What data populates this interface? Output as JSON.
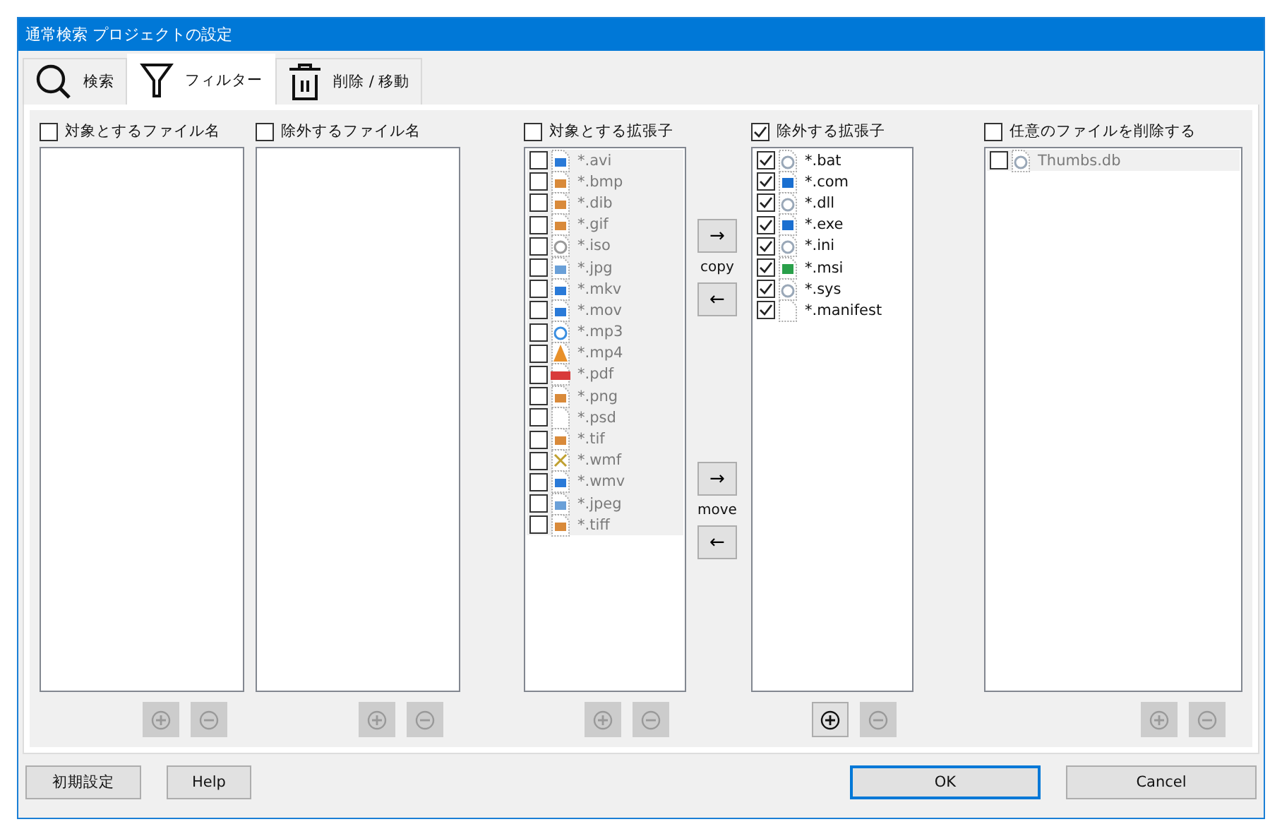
{
  "window": {
    "title": "通常検索 プロジェクトの設定"
  },
  "tabs": [
    {
      "label": "検索",
      "kind": "search",
      "selected": false
    },
    {
      "label": "フィルター",
      "kind": "filter",
      "selected": true
    },
    {
      "label": "削除 / 移動",
      "kind": "trash",
      "selected": false
    }
  ],
  "lists": [
    {
      "label": "対象とするファイル名",
      "checked": false,
      "add_disabled": true,
      "remove_disabled": true
    },
    {
      "label": "除外するファイル名",
      "checked": false,
      "add_disabled": true,
      "remove_disabled": true
    },
    {
      "label": "対象とする拡張子",
      "checked": false,
      "items": [
        {
          "name": "*.avi",
          "checked": false,
          "dimmed": true,
          "kind": "video"
        },
        {
          "name": "*.bmp",
          "checked": false,
          "dimmed": true,
          "kind": "image"
        },
        {
          "name": "*.dib",
          "checked": false,
          "dimmed": true,
          "kind": "image"
        },
        {
          "name": "*.gif",
          "checked": false,
          "dimmed": true,
          "kind": "image"
        },
        {
          "name": "*.iso",
          "checked": false,
          "dimmed": true,
          "kind": "disc"
        },
        {
          "name": "*.jpg",
          "checked": false,
          "dimmed": true,
          "kind": "photo"
        },
        {
          "name": "*.mkv",
          "checked": false,
          "dimmed": true,
          "kind": "video"
        },
        {
          "name": "*.mov",
          "checked": false,
          "dimmed": true,
          "kind": "video"
        },
        {
          "name": "*.mp3",
          "checked": false,
          "dimmed": true,
          "kind": "audio"
        },
        {
          "name": "*.mp4",
          "checked": false,
          "dimmed": true,
          "kind": "cone"
        },
        {
          "name": "*.pdf",
          "checked": false,
          "dimmed": true,
          "kind": "pdf"
        },
        {
          "name": "*.png",
          "checked": false,
          "dimmed": true,
          "kind": "image"
        },
        {
          "name": "*.psd",
          "checked": false,
          "dimmed": true,
          "kind": "blank"
        },
        {
          "name": "*.tif",
          "checked": false,
          "dimmed": true,
          "kind": "image"
        },
        {
          "name": "*.wmf",
          "checked": false,
          "dimmed": true,
          "kind": "drawing"
        },
        {
          "name": "*.wmv",
          "checked": false,
          "dimmed": true,
          "kind": "video"
        },
        {
          "name": "*.jpeg",
          "checked": false,
          "dimmed": true,
          "kind": "photo"
        },
        {
          "name": "*.tiff",
          "checked": false,
          "dimmed": true,
          "kind": "image"
        }
      ],
      "add_disabled": true,
      "remove_disabled": true
    },
    {
      "label": "除外する拡張子",
      "checked": true,
      "items": [
        {
          "name": "*.bat",
          "checked": true,
          "dimmed": false,
          "kind": "gear"
        },
        {
          "name": "*.com",
          "checked": true,
          "dimmed": false,
          "kind": "window"
        },
        {
          "name": "*.dll",
          "checked": true,
          "dimmed": false,
          "kind": "gear"
        },
        {
          "name": "*.exe",
          "checked": true,
          "dimmed": false,
          "kind": "window"
        },
        {
          "name": "*.ini",
          "checked": true,
          "dimmed": false,
          "kind": "gear"
        },
        {
          "name": "*.msi",
          "checked": true,
          "dimmed": false,
          "kind": "installer"
        },
        {
          "name": "*.sys",
          "checked": true,
          "dimmed": false,
          "kind": "gear"
        },
        {
          "name": "*.manifest",
          "checked": true,
          "dimmed": false,
          "kind": "blank"
        }
      ],
      "add_disabled": false,
      "remove_disabled": true
    },
    {
      "label": "任意のファイルを削除する",
      "checked": false,
      "items": [
        {
          "name": "Thumbs.db",
          "checked": false,
          "dimmed": true,
          "kind": "gear"
        }
      ],
      "add_disabled": true,
      "remove_disabled": true
    }
  ],
  "transfers": [
    {
      "right": "→",
      "caption": "copy",
      "left": "←"
    },
    {
      "right": "→",
      "caption": "move",
      "left": "←"
    }
  ],
  "footer_left": [
    "初期設定",
    "Help"
  ],
  "footer_right": [
    {
      "label": "OK",
      "default": true
    },
    {
      "label": "Cancel",
      "default": false
    }
  ]
}
